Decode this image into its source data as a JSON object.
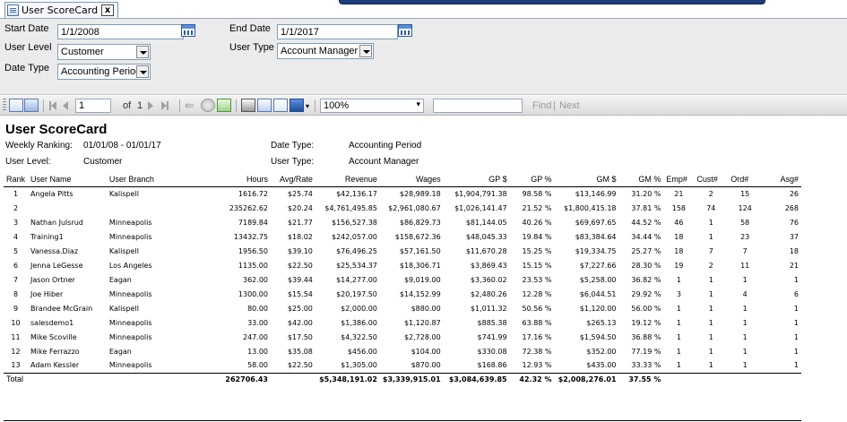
{
  "tab": {
    "title": "User ScoreCard",
    "close": "x"
  },
  "params": {
    "start_date_label": "Start Date",
    "start_date_value": "1/1/2008",
    "end_date_label": "End Date",
    "end_date_value": "1/1/2017",
    "user_level_label": "User Level",
    "user_level_value": "Customer",
    "user_type_label": "User Type",
    "user_type_value": "Account Manager",
    "date_type_label": "Date Type",
    "date_type_value": "Accounting Period"
  },
  "toolbar": {
    "page_value": "1",
    "of_label": "of",
    "total_pages": "1",
    "zoom_value": "100%",
    "find_label": "Find",
    "separator": "|",
    "next_label": "Next"
  },
  "report": {
    "title": "User ScoreCard",
    "weekly_ranking_label": "Weekly Ranking:",
    "weekly_ranking_value": "01/01/08 - 01/01/17",
    "user_level_label": "User Level:",
    "user_level_value": "Customer",
    "date_type_label": "Date Type:",
    "date_type_value": "Accounting Period",
    "user_type_label": "User Type:",
    "user_type_value": "Account Manager",
    "columns": [
      "Rank",
      "User Name",
      "User Branch",
      "Hours",
      "Avg/Rate",
      "Revenue",
      "Wages",
      "GP $",
      "GP %",
      "GM $",
      "GM %",
      "Emp#",
      "Cust#",
      "Ord#",
      "Asg#"
    ],
    "rows": [
      [
        "1",
        "Angela Pitts",
        "Kalispell",
        "1616.72",
        "$25.74",
        "$42,136.17",
        "$28,989.18",
        "$1,904,791.38",
        "98.58 %",
        "$13,146.99",
        "31.20 %",
        "21",
        "2",
        "15",
        "26"
      ],
      [
        "2",
        "",
        "",
        "235262.62",
        "$20.24",
        "$4,761,495.85",
        "$2,961,080.67",
        "$1,026,141.47",
        "21.52 %",
        "$1,800,415.18",
        "37.81 %",
        "158",
        "74",
        "124",
        "268"
      ],
      [
        "3",
        "Nathan Julsrud",
        "Minneapolis",
        "7189.84",
        "$21.77",
        "$156,527.38",
        "$86,829.73",
        "$81,144.05",
        "40.26 %",
        "$69,697.65",
        "44.52 %",
        "46",
        "1",
        "58",
        "76"
      ],
      [
        "4",
        "Training1",
        "Minneapolis",
        "13432.75",
        "$18.02",
        "$242,057.00",
        "$158,672.36",
        "$48,045.33",
        "19.84 %",
        "$83,384.64",
        "34.44 %",
        "18",
        "1",
        "23",
        "37"
      ],
      [
        "5",
        "Vanessa.Diaz",
        "Kalispell",
        "1956.50",
        "$39.10",
        "$76,496.25",
        "$57,161.50",
        "$11,670.28",
        "15.25 %",
        "$19,334.75",
        "25.27 %",
        "18",
        "7",
        "7",
        "18"
      ],
      [
        "6",
        "Jenna LeGesse",
        "Los Angeles",
        "1135.00",
        "$22.50",
        "$25,534.37",
        "$18,306.71",
        "$3,869.43",
        "15.15 %",
        "$7,227.66",
        "28.30 %",
        "19",
        "2",
        "11",
        "21"
      ],
      [
        "7",
        "Jason Ortner",
        "Eagan",
        "362.00",
        "$39.44",
        "$14,277.00",
        "$9,019.00",
        "$3,360.02",
        "23.53 %",
        "$5,258.00",
        "36.82 %",
        "1",
        "1",
        "1",
        "1"
      ],
      [
        "8",
        "Joe Hiber",
        "Minneapolis",
        "1300.00",
        "$15.54",
        "$20,197.50",
        "$14,152.99",
        "$2,480.26",
        "12.28 %",
        "$6,044.51",
        "29.92 %",
        "3",
        "1",
        "4",
        "6"
      ],
      [
        "9",
        "Brandee McGrain",
        "Kalispell",
        "80.00",
        "$25.00",
        "$2,000.00",
        "$880.00",
        "$1,011.32",
        "50.56 %",
        "$1,120.00",
        "56.00 %",
        "1",
        "1",
        "1",
        "1"
      ],
      [
        "10",
        "salesdemo1",
        "Minneapolis",
        "33.00",
        "$42.00",
        "$1,386.00",
        "$1,120.87",
        "$885.38",
        "63.88 %",
        "$265.13",
        "19.12 %",
        "1",
        "1",
        "1",
        "1"
      ],
      [
        "11",
        "Mike Scoville",
        "Minneapolis",
        "247.00",
        "$17.50",
        "$4,322.50",
        "$2,728.00",
        "$741.99",
        "17.16 %",
        "$1,594.50",
        "36.88 %",
        "1",
        "1",
        "1",
        "1"
      ],
      [
        "12",
        "Mike Ferrazzo",
        "Eagan",
        "13.00",
        "$35.08",
        "$456.00",
        "$104.00",
        "$330.08",
        "72.38 %",
        "$352.00",
        "77.19 %",
        "1",
        "1",
        "1",
        "1"
      ],
      [
        "13",
        "Adam Kessler",
        "Minneapolis",
        "58.00",
        "$22.50",
        "$1,305.00",
        "$870.00",
        "$168.86",
        "12.93 %",
        "$435.00",
        "33.33 %",
        "1",
        "1",
        "1",
        "1"
      ]
    ],
    "total": {
      "label": "Total",
      "hours": "262706.43",
      "revenue": "$5,348,191.02",
      "wages": "$3,339,915.01",
      "gp": "$3,084,639.85",
      "gp_pct": "42.32 %",
      "gm": "$2,008,276.01",
      "gm_pct": "37.55 %"
    }
  }
}
